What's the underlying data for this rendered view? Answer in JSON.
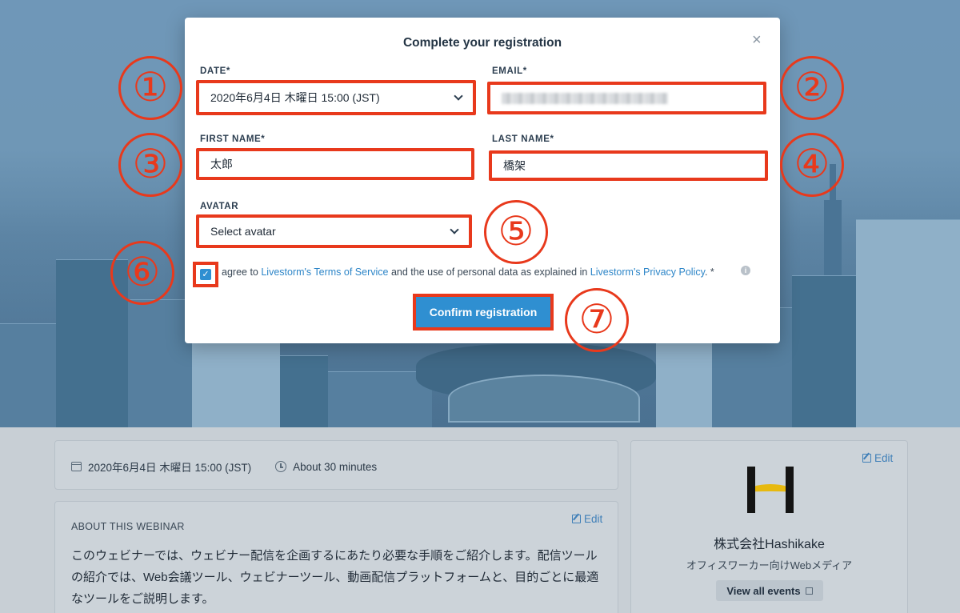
{
  "modal": {
    "title": "Complete your registration",
    "close_glyph": "×",
    "date_label": "DATE*",
    "date_value": "2020年6月4日 木曜日 15:00 (JST)",
    "email_label": "EMAIL*",
    "first_name_label": "FIRST NAME*",
    "first_name_value": "太郎",
    "last_name_label": "LAST NAME*",
    "last_name_value": "橋架",
    "avatar_label": "AVATAR",
    "avatar_value": "Select avatar",
    "consent": {
      "checked": true,
      "check_glyph": "✓",
      "prefix": "agree to ",
      "terms_link": "Livestorm's Terms of Service",
      "middle": " and the use of personal data as explained in ",
      "privacy_link": "Livestorm's Privacy Policy",
      "suffix": ". *",
      "info_glyph": "i"
    },
    "confirm_button": "Confirm registration"
  },
  "annotations": [
    "①",
    "②",
    "③",
    "④",
    "⑤",
    "⑥",
    "⑦"
  ],
  "event": {
    "date": "2020年6月4日 木曜日 15:00 (JST)",
    "duration": "About 30 minutes"
  },
  "about": {
    "title": "ABOUT THIS WEBINAR",
    "edit": "Edit",
    "text": "このウェビナーでは、ウェビナー配信を企画するにあたり必要な手順をご紹介します。配信ツールの紹介では、Web会議ツール、ウェビナーツール、動画配信プラットフォームと、目的ごとに最適なツールをご説明します。"
  },
  "organizer": {
    "edit": "Edit",
    "name": "株式会社Hashikake",
    "subtitle": "オフィスワーカー向けWebメディア",
    "view_all": "View all events"
  },
  "colors": {
    "annotation_red": "#e8391c",
    "accent_blue": "#2f8fd1",
    "logo_yellow": "#e7b90f"
  }
}
